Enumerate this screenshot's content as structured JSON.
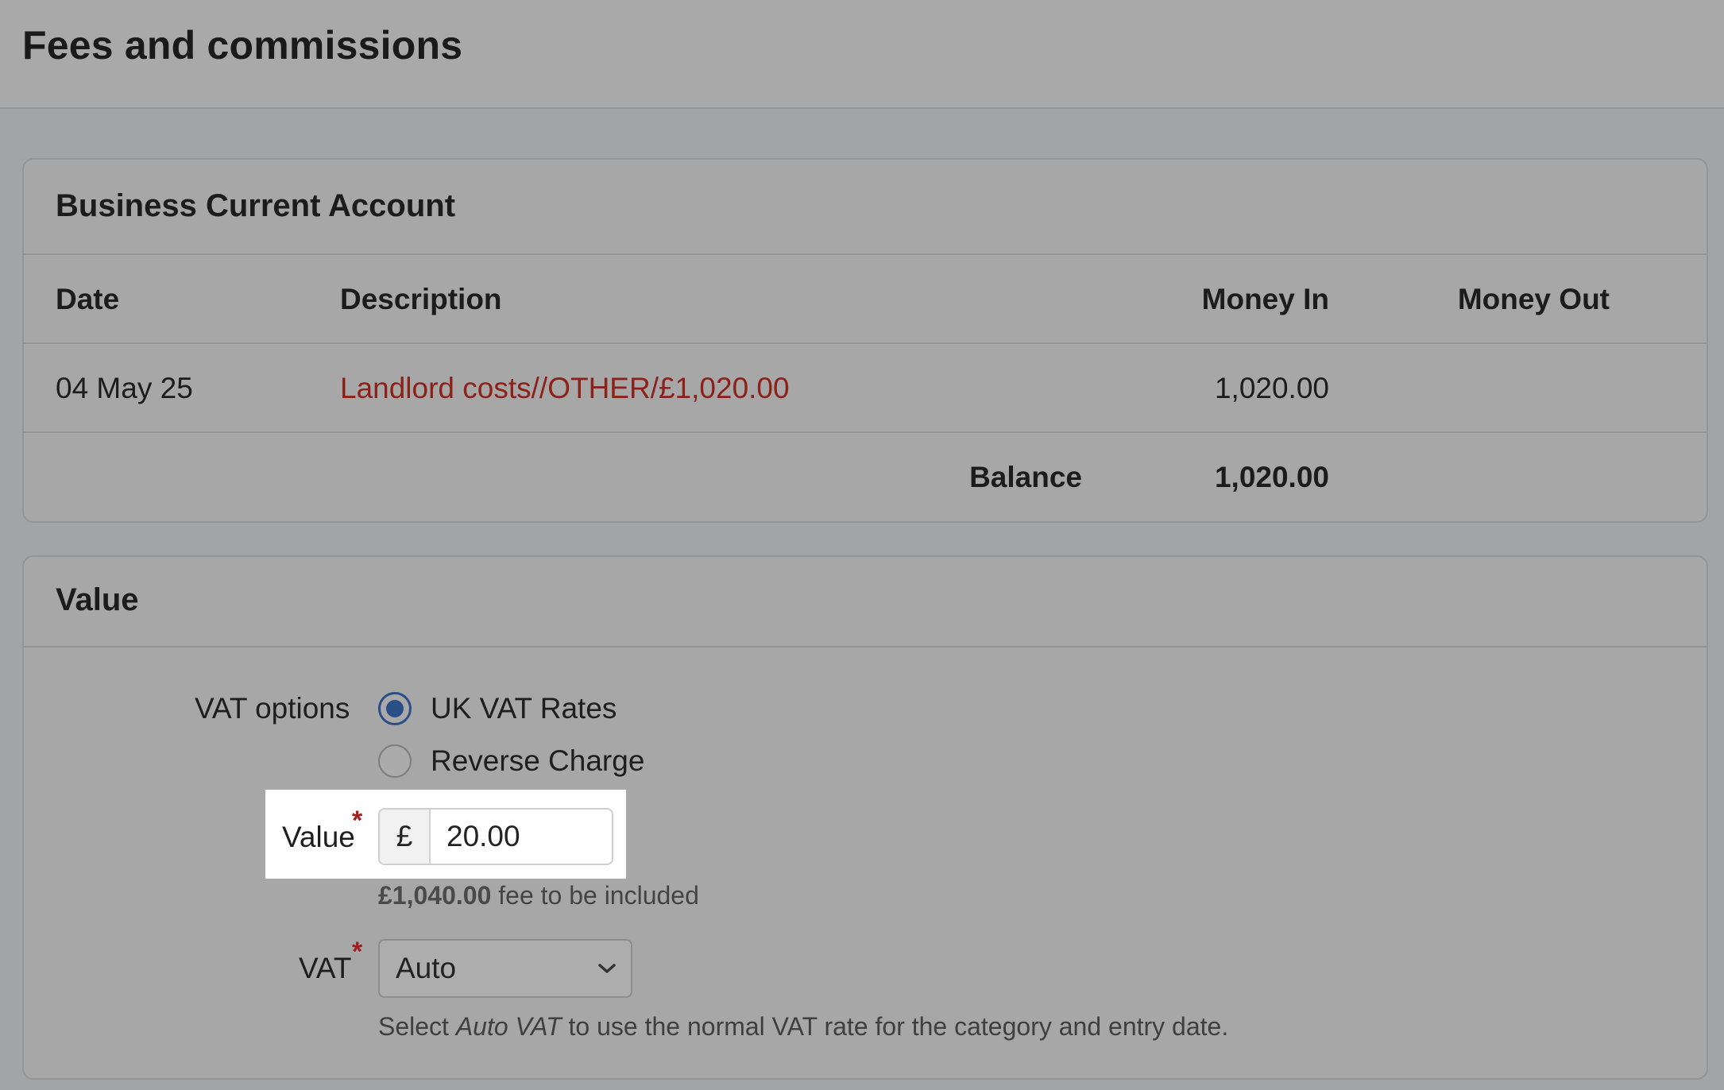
{
  "header": {
    "title": "Fees and commissions"
  },
  "account_card": {
    "title": "Business Current Account",
    "columns": {
      "date": "Date",
      "description": "Description",
      "money_in": "Money In",
      "money_out": "Money Out"
    },
    "rows": [
      {
        "date": "04 May 25",
        "description": "Landlord costs//OTHER/£1,020.00",
        "money_in": "1,020.00",
        "money_out": ""
      }
    ],
    "balance": {
      "label": "Balance",
      "money_in": "1,020.00"
    }
  },
  "value_card": {
    "title": "Value",
    "vat_options": {
      "label": "VAT options",
      "options": [
        {
          "label": "UK VAT Rates",
          "checked": true
        },
        {
          "label": "Reverse Charge",
          "checked": false
        }
      ]
    },
    "value_field": {
      "label": "Value",
      "required_mark": "*",
      "currency_symbol": "£",
      "value": "20.00",
      "hint_amount": "£1,040.00",
      "hint_text": " fee to be included"
    },
    "vat_field": {
      "label": "VAT",
      "required_mark": "*",
      "selected": "Auto",
      "help_prefix": "Select ",
      "help_em": "Auto VAT",
      "help_suffix": " to use the normal VAT rate for the category and entry date."
    }
  },
  "colors": {
    "link": "#8c2119",
    "radio_accent": "#2a4e86",
    "required": "#a21e1e"
  },
  "icons": {
    "select": "chevron-down-icon"
  }
}
